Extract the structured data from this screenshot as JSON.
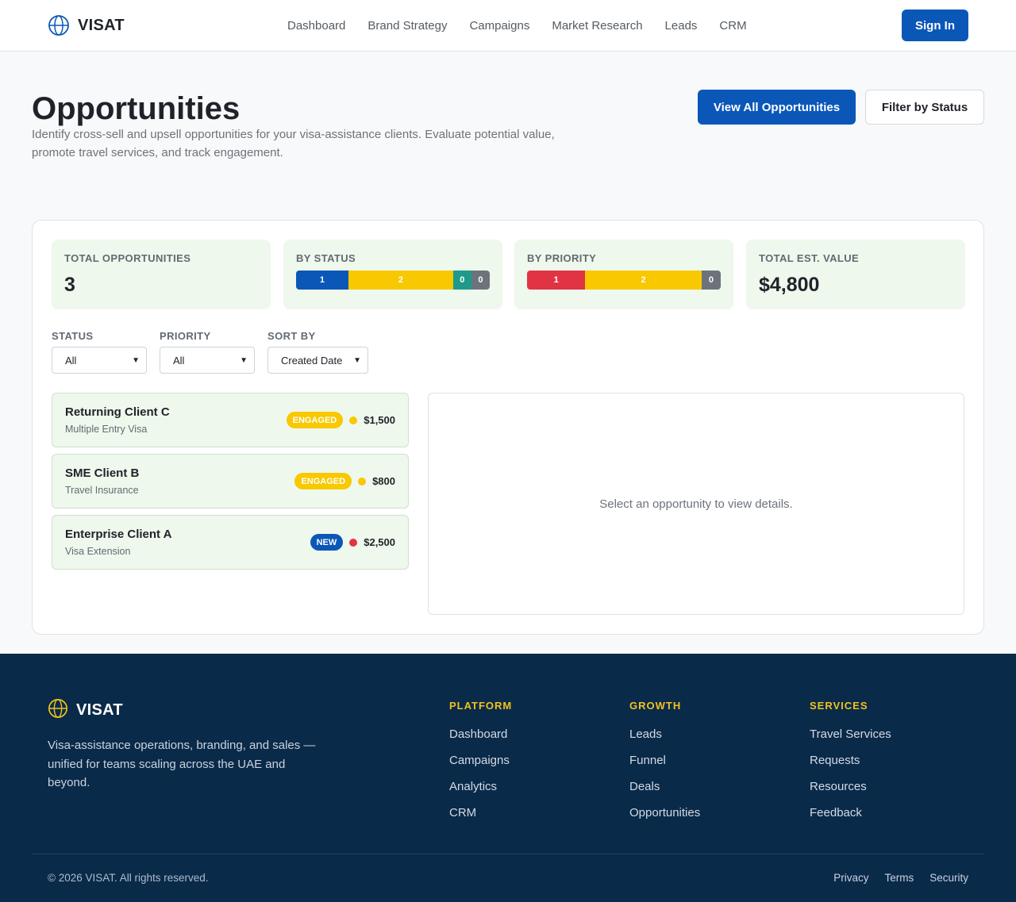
{
  "header": {
    "brand": "VISAT",
    "nav": [
      "Dashboard",
      "Brand Strategy",
      "Campaigns",
      "Market Research",
      "Leads",
      "CRM"
    ],
    "sign_in": "Sign In"
  },
  "hero": {
    "title": "Opportunities",
    "subtitle": "Identify cross-sell and upsell opportunities for your visa-assistance clients. Evaluate potential value, promote travel services, and track engagement.",
    "primary_button": "View All Opportunities",
    "secondary_button": "Filter by Status"
  },
  "stats": {
    "total_label": "TOTAL OPPORTUNITIES",
    "total_value": "3",
    "status_label": "BY STATUS",
    "status_segments": [
      {
        "value": "1",
        "color": "#0b57b8",
        "share": 1
      },
      {
        "value": "2",
        "color": "#f8c800",
        "share": 2
      },
      {
        "value": "0",
        "color": "#1f9a8a",
        "share": 0.35
      },
      {
        "value": "0",
        "color": "#6c737b",
        "share": 0.35
      }
    ],
    "priority_label": "BY PRIORITY",
    "priority_segments": [
      {
        "value": "1",
        "color": "#e03444",
        "share": 1
      },
      {
        "value": "2",
        "color": "#f8c800",
        "share": 2
      },
      {
        "value": "0",
        "color": "#6c737b",
        "share": 0.33
      }
    ],
    "value_label": "TOTAL EST. VALUE",
    "value_value": "$4,800"
  },
  "filters": {
    "status": {
      "label": "STATUS",
      "value": "All"
    },
    "priority": {
      "label": "PRIORITY",
      "value": "All"
    },
    "sort": {
      "label": "SORT BY",
      "value": "Created Date"
    }
  },
  "opportunities": [
    {
      "name": "Returning Client C",
      "type": "Multiple Entry Visa",
      "status": "ENGAGED",
      "status_color": "#f8c800",
      "status_text_color": "#ffffff",
      "priority_color": "#f8c800",
      "value": "$1,500"
    },
    {
      "name": "SME Client B",
      "type": "Travel Insurance",
      "status": "ENGAGED",
      "status_color": "#f8c800",
      "status_text_color": "#ffffff",
      "priority_color": "#f8c800",
      "value": "$800"
    },
    {
      "name": "Enterprise Client A",
      "type": "Visa Extension",
      "status": "NEW",
      "status_color": "#0b57b8",
      "status_text_color": "#ffffff",
      "priority_color": "#e03444",
      "value": "$2,500"
    }
  ],
  "detail": {
    "empty_message": "Select an opportunity to view details."
  },
  "footer": {
    "brand": "VISAT",
    "description": "Visa-assistance operations, branding, and sales — unified for teams scaling across the UAE and beyond.",
    "columns": [
      {
        "heading": "PLATFORM",
        "links": [
          "Dashboard",
          "Campaigns",
          "Analytics",
          "CRM"
        ]
      },
      {
        "heading": "GROWTH",
        "links": [
          "Leads",
          "Funnel",
          "Deals",
          "Opportunities"
        ]
      },
      {
        "heading": "SERVICES",
        "links": [
          "Travel Services",
          "Requests",
          "Resources",
          "Feedback"
        ]
      }
    ],
    "copyright": "© 2026 VISAT. All rights reserved.",
    "legal": [
      "Privacy",
      "Terms",
      "Security"
    ]
  }
}
